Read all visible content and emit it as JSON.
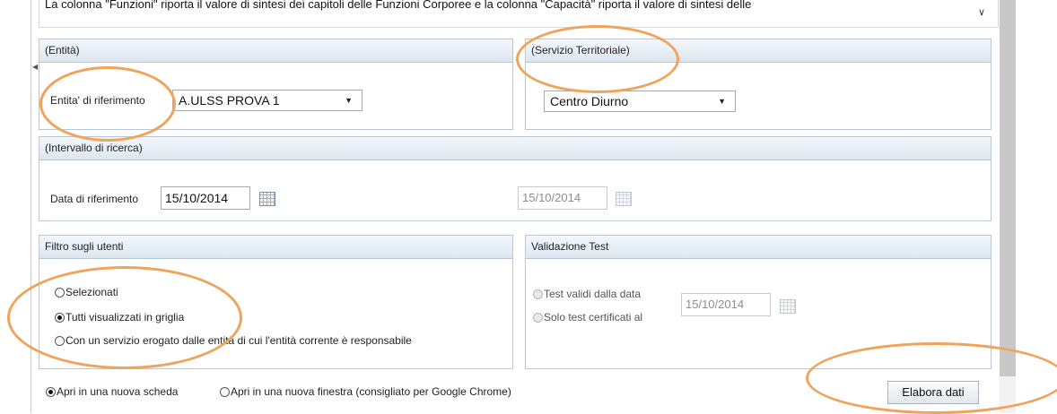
{
  "notice": {
    "text": "La colonna \"Funzioni\" riporta il valore di sintesi dei capitoli delle Funzioni Corporee e la colonna \"Capacità\" riporta il valore di sintesi delle",
    "toggle_icon": "chevron-down-icon"
  },
  "entity": {
    "header": "(Entità)",
    "label": "Entita' di riferimento",
    "value": "A.ULSS PROVA 1"
  },
  "service": {
    "header": "(Servizio Territoriale)",
    "value": "Centro Diurno"
  },
  "interval": {
    "header": "(Intervallo di ricerca)",
    "label": "Data di riferimento",
    "date_from": "15/10/2014",
    "date_to": "15/10/2014"
  },
  "filter": {
    "header": "Filtro sugli utenti",
    "options": [
      {
        "label": "Selezionati",
        "checked": false
      },
      {
        "label": "Tutti visualizzati in griglia",
        "checked": true
      },
      {
        "label": "Con un servizio erogato dalle entità di cui l'entità corrente è responsabile",
        "checked": false
      }
    ]
  },
  "validation": {
    "header": "Validazione Test",
    "option1": "Test validi dalla data",
    "option2": "Solo test certificati al",
    "date": "15/10/2014"
  },
  "open_mode": {
    "new_tab": "Apri in una nuova scheda",
    "new_window": "Apri in una nuova finestra (consigliato per Google Chrome)"
  },
  "actions": {
    "process": "Elabora dati"
  },
  "annotation_color": "#f0a35a"
}
